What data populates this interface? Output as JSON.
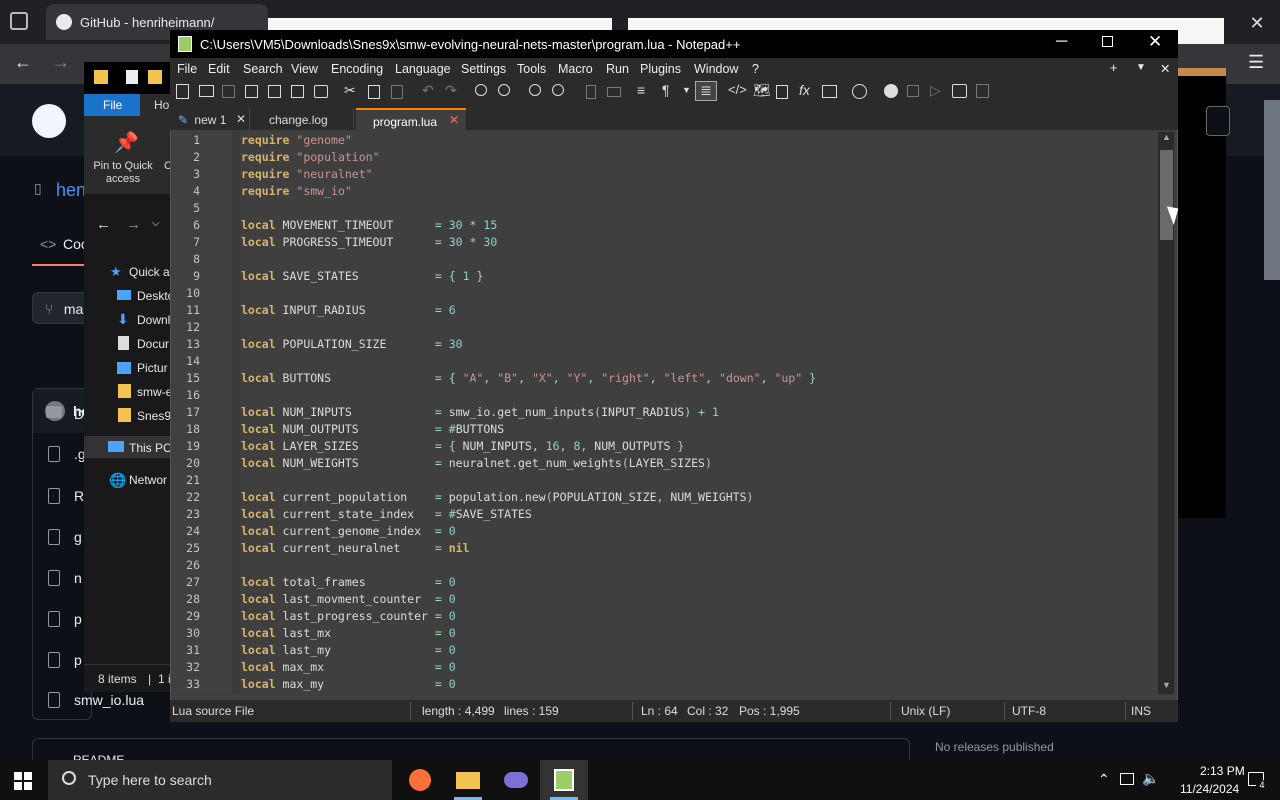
{
  "browser": {
    "tab_title": "GitHub - henriheimann/",
    "repo_short": "hen",
    "code_tab": "Coc",
    "branch_short": "ma",
    "owner_short": "he",
    "file_last": "smw_io.lua",
    "files_short": [
      "D",
      ".g",
      "R",
      "g",
      "n",
      "p",
      "p"
    ],
    "readme_label": "README",
    "no_releases": "No releases published"
  },
  "explorer": {
    "file_tab": "File",
    "home_tab": "Ho",
    "pin_label": "Pin to Quick access",
    "copy_short": "C",
    "tree": [
      {
        "label": "Quick a",
        "icon": "star-icon"
      },
      {
        "label": "Deskto",
        "icon": "desktop-icon"
      },
      {
        "label": "Downl",
        "icon": "download-icon"
      },
      {
        "label": "Docur",
        "icon": "document-icon"
      },
      {
        "label": "Pictur",
        "icon": "pictures-icon"
      },
      {
        "label": "smw-e",
        "icon": "folder-icon"
      },
      {
        "label": "Snes9x",
        "icon": "folder-icon"
      },
      {
        "label": "This PC",
        "icon": "pc-icon"
      },
      {
        "label": "Networ",
        "icon": "network-icon"
      }
    ],
    "status_items": "8 items",
    "status_sel": "1 i"
  },
  "npp": {
    "title": "C:\\Users\\VM5\\Downloads\\Snes9x\\smw-evolving-neural-nets-master\\program.lua - Notepad++",
    "menu": [
      "File",
      "Edit",
      "Search",
      "View",
      "Encoding",
      "Language",
      "Settings",
      "Tools",
      "Macro",
      "Run",
      "Plugins",
      "Window",
      "?"
    ],
    "tabs": [
      "new 1",
      "change.log",
      "program.lua"
    ],
    "active_tab": "program.lua",
    "status": {
      "filetype": "Lua source File",
      "length": "length : 4,499",
      "lines": "lines : 159",
      "ln": "Ln : 64",
      "col": "Col : 32",
      "pos": "Pos : 1,995",
      "eol": "Unix (LF)",
      "encoding": "UTF-8",
      "mode": "INS"
    },
    "code": [
      [
        [
          "kw",
          "require"
        ],
        [
          "t",
          " "
        ],
        [
          "str",
          "\"genome\""
        ]
      ],
      [
        [
          "kw",
          "require"
        ],
        [
          "t",
          " "
        ],
        [
          "str",
          "\"population\""
        ]
      ],
      [
        [
          "kw",
          "require"
        ],
        [
          "t",
          " "
        ],
        [
          "str",
          "\"neuralnet\""
        ]
      ],
      [
        [
          "kw",
          "require"
        ],
        [
          "t",
          " "
        ],
        [
          "str",
          "\"smw_io\""
        ]
      ],
      [],
      [
        [
          "kw",
          "local"
        ],
        [
          "t",
          " MOVEMENT_TIMEOUT      "
        ],
        [
          "op",
          "="
        ],
        [
          "t",
          " "
        ],
        [
          "num",
          "30"
        ],
        [
          "t",
          " "
        ],
        [
          "op",
          "*"
        ],
        [
          "t",
          " "
        ],
        [
          "num",
          "15"
        ]
      ],
      [
        [
          "kw",
          "local"
        ],
        [
          "t",
          " PROGRESS_TIMEOUT      "
        ],
        [
          "op",
          "="
        ],
        [
          "t",
          " "
        ],
        [
          "num",
          "30"
        ],
        [
          "t",
          " "
        ],
        [
          "op",
          "*"
        ],
        [
          "t",
          " "
        ],
        [
          "num",
          "30"
        ]
      ],
      [],
      [
        [
          "kw",
          "local"
        ],
        [
          "t",
          " SAVE_STATES           "
        ],
        [
          "op",
          "="
        ],
        [
          "t",
          " "
        ],
        [
          "op",
          "{"
        ],
        [
          "t",
          " "
        ],
        [
          "num",
          "1"
        ],
        [
          "t",
          " "
        ],
        [
          "op",
          "}"
        ]
      ],
      [],
      [
        [
          "kw",
          "local"
        ],
        [
          "t",
          " INPUT_RADIUS          "
        ],
        [
          "op",
          "="
        ],
        [
          "t",
          " "
        ],
        [
          "num",
          "6"
        ]
      ],
      [],
      [
        [
          "kw",
          "local"
        ],
        [
          "t",
          " POPULATION_SIZE       "
        ],
        [
          "op",
          "="
        ],
        [
          "t",
          " "
        ],
        [
          "num",
          "30"
        ]
      ],
      [],
      [
        [
          "kw",
          "local"
        ],
        [
          "t",
          " BUTTONS               "
        ],
        [
          "op",
          "="
        ],
        [
          "t",
          " "
        ],
        [
          "op",
          "{"
        ],
        [
          "t",
          " "
        ],
        [
          "str",
          "\"A\""
        ],
        [
          "op",
          ","
        ],
        [
          "t",
          " "
        ],
        [
          "str",
          "\"B\""
        ],
        [
          "op",
          ","
        ],
        [
          "t",
          " "
        ],
        [
          "str",
          "\"X\""
        ],
        [
          "op",
          ","
        ],
        [
          "t",
          " "
        ],
        [
          "str",
          "\"Y\""
        ],
        [
          "op",
          ","
        ],
        [
          "t",
          " "
        ],
        [
          "str",
          "\"right\""
        ],
        [
          "op",
          ","
        ],
        [
          "t",
          " "
        ],
        [
          "str",
          "\"left\""
        ],
        [
          "op",
          ","
        ],
        [
          "t",
          " "
        ],
        [
          "str",
          "\"down\""
        ],
        [
          "op",
          ","
        ],
        [
          "t",
          " "
        ],
        [
          "str",
          "\"up\""
        ],
        [
          "t",
          " "
        ],
        [
          "op",
          "}"
        ]
      ],
      [],
      [
        [
          "kw",
          "local"
        ],
        [
          "t",
          " NUM_INPUTS            "
        ],
        [
          "op",
          "="
        ],
        [
          "t",
          " smw_io"
        ],
        [
          "op",
          "."
        ],
        [
          "t",
          "get_num_inputs"
        ],
        [
          "op",
          "("
        ],
        [
          "t",
          "INPUT_RADIUS"
        ],
        [
          "op",
          ")"
        ],
        [
          "t",
          " "
        ],
        [
          "op",
          "+"
        ],
        [
          "t",
          " "
        ],
        [
          "num",
          "1"
        ]
      ],
      [
        [
          "kw",
          "local"
        ],
        [
          "t",
          " NUM_OUTPUTS           "
        ],
        [
          "op",
          "="
        ],
        [
          "t",
          " "
        ],
        [
          "op",
          "#"
        ],
        [
          "t",
          "BUTTONS"
        ]
      ],
      [
        [
          "kw",
          "local"
        ],
        [
          "t",
          " LAYER_SIZES           "
        ],
        [
          "op",
          "="
        ],
        [
          "t",
          " "
        ],
        [
          "op",
          "{"
        ],
        [
          "t",
          " NUM_INPUTS"
        ],
        [
          "op",
          ","
        ],
        [
          "t",
          " "
        ],
        [
          "num",
          "16"
        ],
        [
          "op",
          ","
        ],
        [
          "t",
          " "
        ],
        [
          "num",
          "8"
        ],
        [
          "op",
          ","
        ],
        [
          "t",
          " NUM_OUTPUTS "
        ],
        [
          "op",
          "}"
        ]
      ],
      [
        [
          "kw",
          "local"
        ],
        [
          "t",
          " NUM_WEIGHTS           "
        ],
        [
          "op",
          "="
        ],
        [
          "t",
          " neuralnet"
        ],
        [
          "op",
          "."
        ],
        [
          "t",
          "get_num_weights"
        ],
        [
          "op",
          "("
        ],
        [
          "t",
          "LAYER_SIZES"
        ],
        [
          "op",
          ")"
        ]
      ],
      [],
      [
        [
          "kw",
          "local"
        ],
        [
          "t",
          " current_population    "
        ],
        [
          "op",
          "="
        ],
        [
          "t",
          " population"
        ],
        [
          "op",
          "."
        ],
        [
          "t",
          "new"
        ],
        [
          "op",
          "("
        ],
        [
          "t",
          "POPULATION_SIZE"
        ],
        [
          "op",
          ","
        ],
        [
          "t",
          " NUM_WEIGHTS"
        ],
        [
          "op",
          ")"
        ]
      ],
      [
        [
          "kw",
          "local"
        ],
        [
          "t",
          " current_state_index   "
        ],
        [
          "op",
          "="
        ],
        [
          "t",
          " "
        ],
        [
          "op",
          "#"
        ],
        [
          "t",
          "SAVE_STATES"
        ]
      ],
      [
        [
          "kw",
          "local"
        ],
        [
          "t",
          " current_genome_index  "
        ],
        [
          "op",
          "="
        ],
        [
          "t",
          " "
        ],
        [
          "num",
          "0"
        ]
      ],
      [
        [
          "kw",
          "local"
        ],
        [
          "t",
          " current_neuralnet     "
        ],
        [
          "op",
          "="
        ],
        [
          "t",
          " "
        ],
        [
          "kw",
          "nil"
        ]
      ],
      [],
      [
        [
          "kw",
          "local"
        ],
        [
          "t",
          " total_frames          "
        ],
        [
          "op",
          "="
        ],
        [
          "t",
          " "
        ],
        [
          "num",
          "0"
        ]
      ],
      [
        [
          "kw",
          "local"
        ],
        [
          "t",
          " last_movment_counter  "
        ],
        [
          "op",
          "="
        ],
        [
          "t",
          " "
        ],
        [
          "num",
          "0"
        ]
      ],
      [
        [
          "kw",
          "local"
        ],
        [
          "t",
          " last_progress_counter "
        ],
        [
          "op",
          "="
        ],
        [
          "t",
          " "
        ],
        [
          "num",
          "0"
        ]
      ],
      [
        [
          "kw",
          "local"
        ],
        [
          "t",
          " last_mx               "
        ],
        [
          "op",
          "="
        ],
        [
          "t",
          " "
        ],
        [
          "num",
          "0"
        ]
      ],
      [
        [
          "kw",
          "local"
        ],
        [
          "t",
          " last_my               "
        ],
        [
          "op",
          "="
        ],
        [
          "t",
          " "
        ],
        [
          "num",
          "0"
        ]
      ],
      [
        [
          "kw",
          "local"
        ],
        [
          "t",
          " max_mx                "
        ],
        [
          "op",
          "="
        ],
        [
          "t",
          " "
        ],
        [
          "num",
          "0"
        ]
      ],
      [
        [
          "kw",
          "local"
        ],
        [
          "t",
          " max_my                "
        ],
        [
          "op",
          "="
        ],
        [
          "t",
          " "
        ],
        [
          "num",
          "0"
        ]
      ]
    ]
  },
  "taskbar": {
    "search_placeholder": "Type here to search",
    "time": "2:13 PM",
    "date": "11/24/2024",
    "notification_count": "4"
  }
}
